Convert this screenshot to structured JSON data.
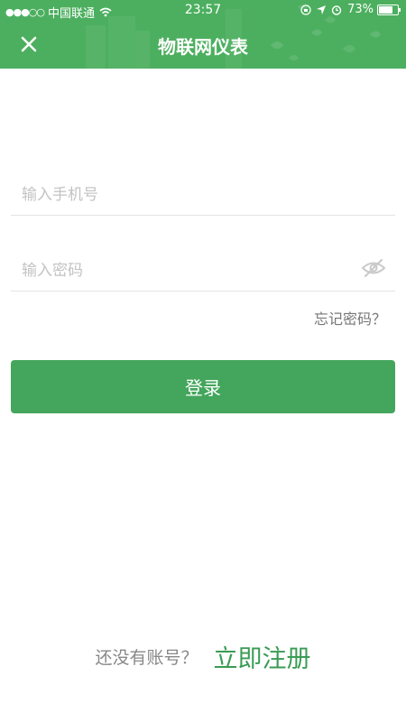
{
  "status_bar": {
    "signal": "●●●○○",
    "carrier": "中国联通",
    "time": "23:57",
    "battery": "73%"
  },
  "nav": {
    "title": "物联网仪表",
    "close_icon": "close-icon"
  },
  "form": {
    "phone_placeholder": "输入手机号",
    "phone_value": "",
    "password_placeholder": "输入密码",
    "password_value": "",
    "forgot": "忘记密码？",
    "login": "登录"
  },
  "footer": {
    "question": "还没有账号？",
    "register": "立即注册"
  },
  "colors": {
    "header": "#4caf5f",
    "button": "#43a65c",
    "accent_text": "#3a9b54"
  }
}
